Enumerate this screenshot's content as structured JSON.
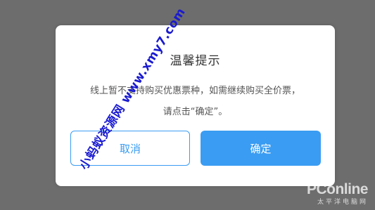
{
  "dialog": {
    "title": "温馨提示",
    "message_line1": "线上暂不支持购买优惠票种，如需继续购买全价票，",
    "message_line2": "请点击“确定”。",
    "cancel_label": "取消",
    "confirm_label": "确定"
  },
  "overlay": {
    "watermark_text": "小蚂蚁资源网 www.xmy7.com",
    "logo_text": "PConline",
    "logo_subtext": "太平洋电脑网"
  },
  "colors": {
    "accent": "#3a9cf2",
    "backdrop": "#6d6d6d",
    "watermark": "#1a1ad0"
  }
}
